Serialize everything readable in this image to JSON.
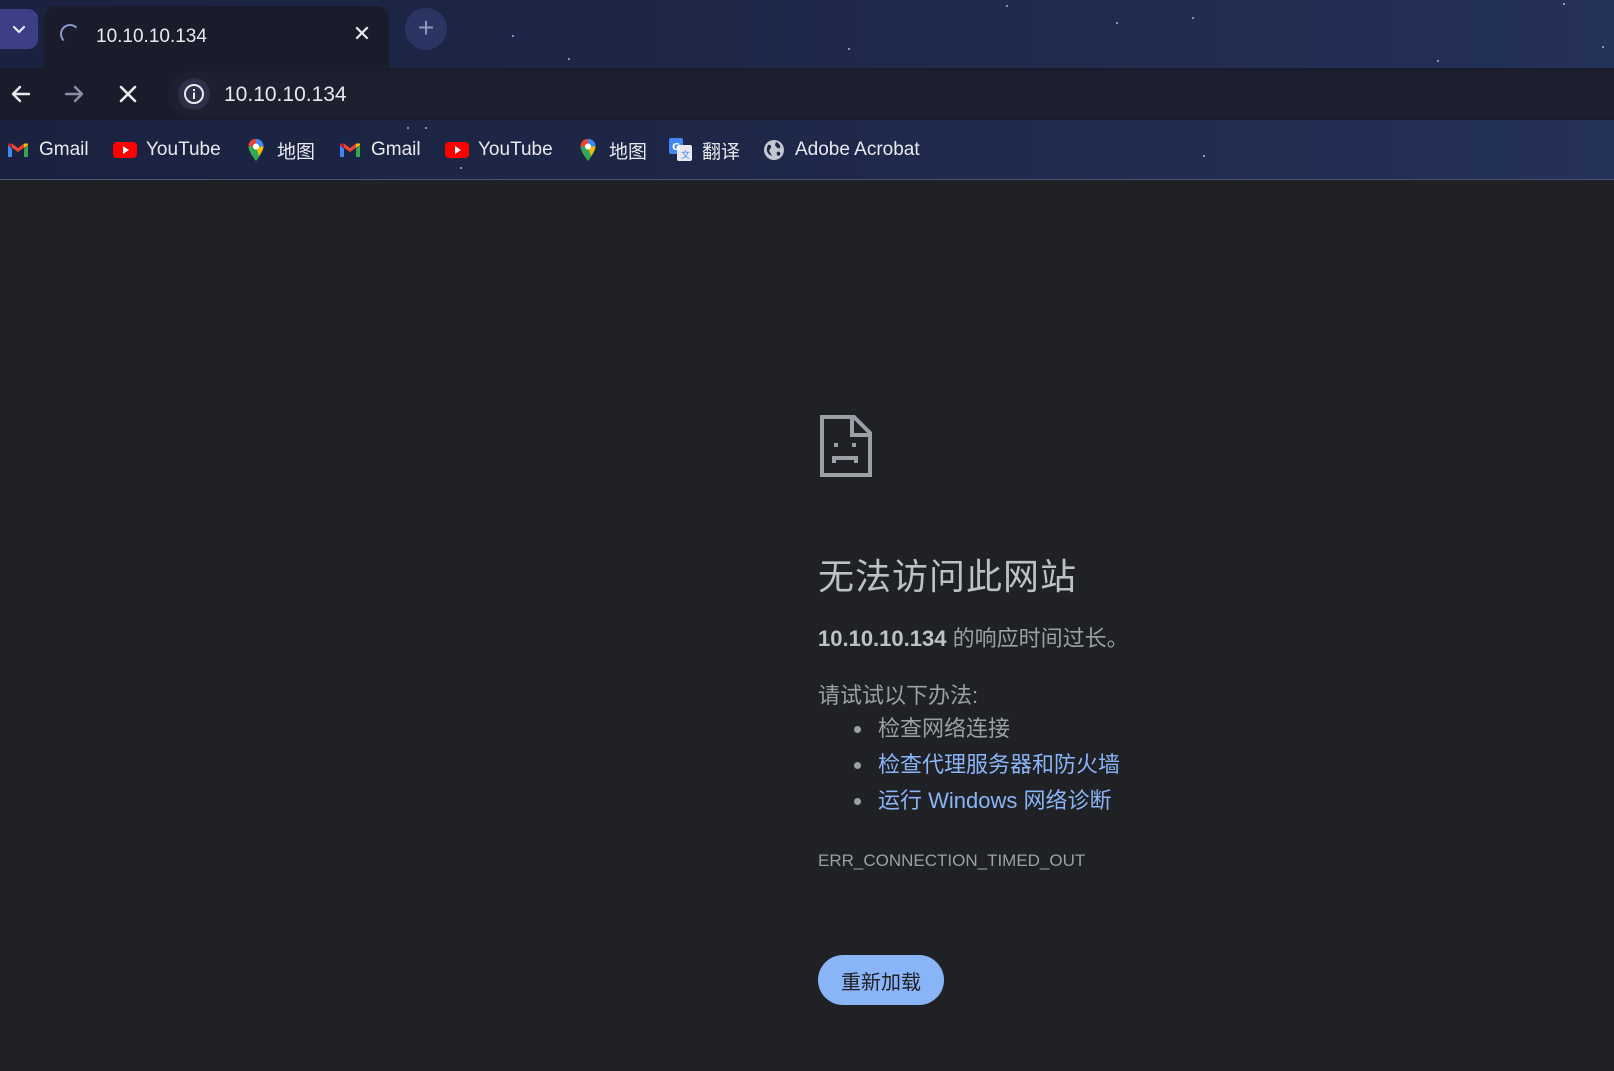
{
  "tab": {
    "title": "10.10.10.134",
    "close_label": "✕",
    "new_tab_label": "+"
  },
  "toolbar": {
    "url": "10.10.10.134"
  },
  "bookmarks": [
    {
      "label": "Gmail",
      "icon": "gmail-icon"
    },
    {
      "label": "YouTube",
      "icon": "youtube-icon"
    },
    {
      "label": "地图",
      "icon": "maps-icon"
    },
    {
      "label": "Gmail",
      "icon": "gmail-icon"
    },
    {
      "label": "YouTube",
      "icon": "youtube-icon"
    },
    {
      "label": "地图",
      "icon": "maps-icon"
    },
    {
      "label": "翻译",
      "icon": "translate-icon"
    },
    {
      "label": "Adobe Acrobat",
      "icon": "globe-icon"
    }
  ],
  "error": {
    "title": "无法访问此网站",
    "host": "10.10.10.134",
    "desc_suffix": " 的响应时间过长。",
    "try_label": "请试试以下办法:",
    "suggestions": [
      {
        "text": "检查网络连接",
        "link": false
      },
      {
        "text": "检查代理服务器和防火墙",
        "link": true
      },
      {
        "text": "运行 Windows 网络诊断",
        "link": true
      }
    ],
    "code": "ERR_CONNECTION_TIMED_OUT",
    "reload_label": "重新加载"
  },
  "colors": {
    "page_bg": "#202124",
    "link": "#8ab4f8",
    "button_bg": "#8ab4f8",
    "text_primary": "#bdc1c6",
    "text_secondary": "#9aa0a6"
  }
}
